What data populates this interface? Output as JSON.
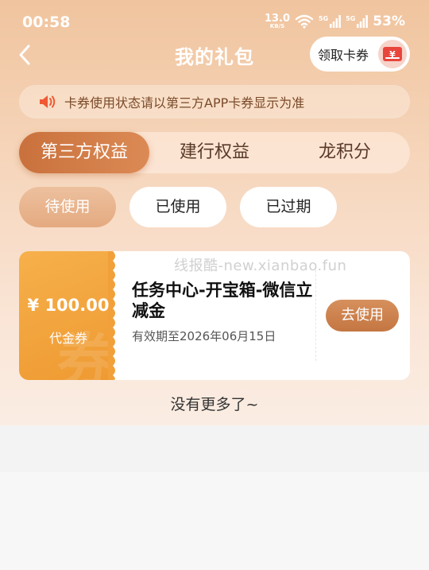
{
  "status_bar": {
    "time": "00:58",
    "net_speed_value": "13.0",
    "net_speed_unit": "KB/S",
    "signal1_label": "5G",
    "signal2_label": "5G",
    "battery": "53%"
  },
  "header": {
    "title": "我的礼包",
    "claim_button_label": "领取卡券",
    "claim_icon_symbol": "¥"
  },
  "notice": {
    "text": "卡券使用状态请以第三方APP卡券显示为准"
  },
  "tabs": [
    {
      "label": "第三方权益",
      "active": true
    },
    {
      "label": "建行权益",
      "active": false
    },
    {
      "label": "龙积分",
      "active": false
    }
  ],
  "filters": [
    {
      "label": "待使用",
      "active": true
    },
    {
      "label": "已使用",
      "active": false
    },
    {
      "label": "已过期",
      "active": false
    }
  ],
  "coupons": [
    {
      "amount": "¥ 100.00",
      "type": "代金券",
      "watermark_char": "券",
      "name": "任务中心-开宝箱-微信立减金",
      "expiry": "有效期至2026年06月15日",
      "action_label": "去使用"
    }
  ],
  "watermark_text": "线报酷-new.xianbao.fun",
  "footer_text": "没有更多了~",
  "colors": {
    "accent": "#c9713d",
    "coupon_orange": "#f2a23a",
    "notice_text": "#7a4a2a",
    "speaker": "#ef5a35"
  }
}
